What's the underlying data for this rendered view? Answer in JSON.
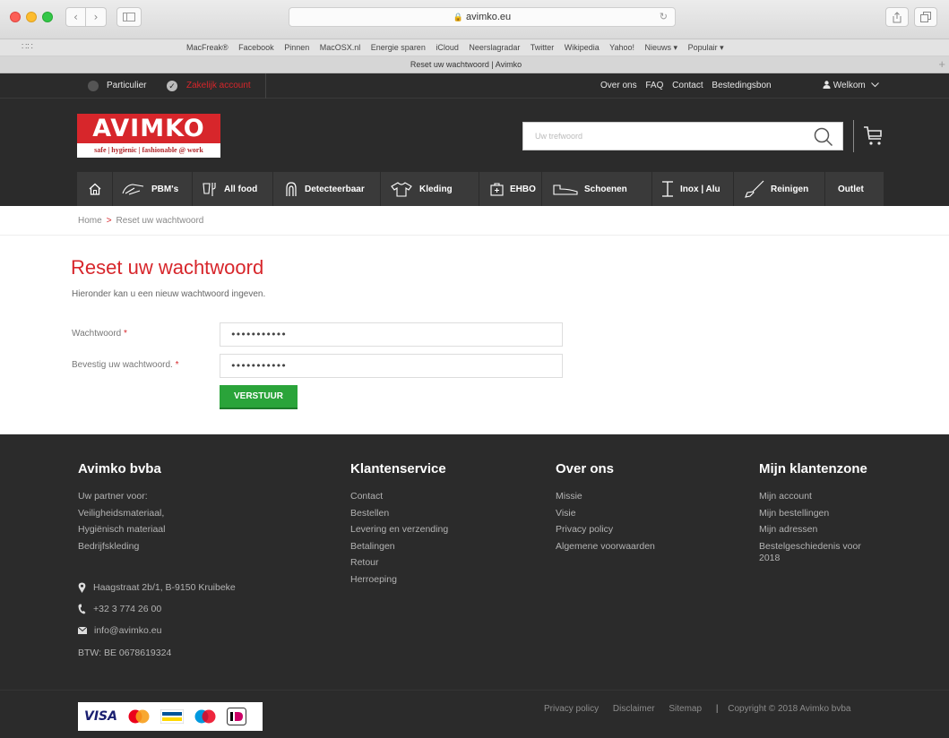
{
  "browser": {
    "url": "avimko.eu",
    "tab_title": "Reset uw wachtwoord | Avimko",
    "favorites": [
      "MacFreak®",
      "Facebook",
      "Pinnen",
      "MacOSX.nl",
      "Energie sparen",
      "iCloud",
      "Neerslagradar",
      "Twitter",
      "Wikipedia",
      "Yahoo!",
      "Nieuws ▾",
      "Populair ▾"
    ]
  },
  "topbar": {
    "particulier": "Particulier",
    "zakelijk": "Zakelijk account",
    "links": [
      "Over ons",
      "FAQ",
      "Contact",
      "Bestedingsbon"
    ],
    "welcome": "Welkom"
  },
  "header": {
    "logo_text": "AVIMKO",
    "logo_tagline": "safe | hygienic | fashionable @ work",
    "search_placeholder": "Uw trefwoord"
  },
  "categories": [
    {
      "label": "PBM's",
      "icon": "pbm-icon"
    },
    {
      "label": "All food",
      "icon": "food-icon"
    },
    {
      "label": "Detecteerbaar",
      "icon": "detect-icon"
    },
    {
      "label": "Kleding",
      "icon": "shirt-icon"
    },
    {
      "label": "EHBO",
      "icon": "firstaid-icon"
    },
    {
      "label": "Schoenen",
      "icon": "shoe-icon"
    },
    {
      "label": "Inox | Alu",
      "icon": "inox-icon"
    },
    {
      "label": "Reinigen",
      "icon": "broom-icon"
    },
    {
      "label": "Outlet",
      "icon": ""
    }
  ],
  "breadcrumb": {
    "home": "Home",
    "current": "Reset uw wachtwoord"
  },
  "form": {
    "title": "Reset uw wachtwoord",
    "intro": "Hieronder kan u een nieuw wachtwoord ingeven.",
    "password_label": "Wachtwoord",
    "password_value": "•••••••••••",
    "confirm_label": "Bevestig uw wachtwoord.",
    "confirm_value": "•••••••••••",
    "required_mark": "*",
    "submit_label": "VERSTUUR"
  },
  "footer": {
    "company": {
      "heading": "Avimko bvba",
      "lines": [
        "Uw partner voor:",
        "Veiligheidsmateriaal,",
        "Hygiënisch materiaal",
        "Bedrijfskleding"
      ],
      "address": "Haagstraat 2b/1, B-9150 Kruibeke",
      "phone": "+32 3 774 26 00",
      "email": "info@avimko.eu",
      "vat": "BTW: BE 0678619324"
    },
    "service": {
      "heading": "Klantenservice",
      "items": [
        "Contact",
        "Bestellen",
        "Levering en verzending",
        "Betalingen",
        "Retour",
        "Herroeping"
      ]
    },
    "about": {
      "heading": "Over ons",
      "items": [
        "Missie",
        "Visie",
        "Privacy policy",
        "Algemene voorwaarden"
      ]
    },
    "account": {
      "heading": "Mijn klantenzone",
      "items": [
        "Mijn account",
        "Mijn bestellingen",
        "Mijn adressen",
        "Bestelgeschiedenis voor 2018"
      ]
    },
    "legal": [
      "Privacy policy",
      "Disclaimer",
      "Sitemap"
    ],
    "copyright": "Copyright © 2018 Avimko bvba",
    "payment_visa": "VISA"
  },
  "colors": {
    "brand_red": "#d7262b",
    "dark_bg": "#2b2b2b",
    "submit_green": "#2aa43a"
  }
}
